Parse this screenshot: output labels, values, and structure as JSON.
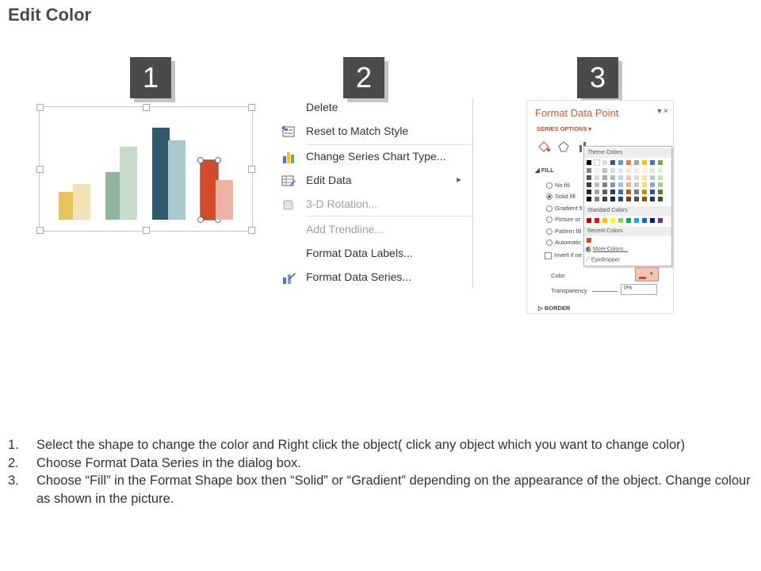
{
  "page": {
    "title": "Edit Color"
  },
  "steps": [
    "1",
    "2",
    "3"
  ],
  "panel1": {
    "bars": [
      {
        "color": "#e8c25a",
        "value": 35
      },
      {
        "color": "#f2e2b5",
        "value": 45
      },
      {
        "color": "#8fb59d",
        "value": 60
      },
      {
        "color": "#c8dccc",
        "value": 92
      },
      {
        "color": "#2f5b6c",
        "value": 116
      },
      {
        "color": "#a9c8d0",
        "value": 100
      },
      {
        "color": "#d14b28",
        "value": 75,
        "selected": true
      },
      {
        "color": "#edb3a3",
        "value": 50
      }
    ]
  },
  "context_menu": {
    "items": [
      {
        "label": "Delete",
        "icon": "none",
        "disabled": false
      },
      {
        "label": "Reset to Match Style",
        "icon": "reset-style-icon",
        "disabled": false
      },
      {
        "label": "Change Series Chart Type...",
        "icon": "chart-type-icon",
        "disabled": false
      },
      {
        "label": "Edit Data",
        "icon": "edit-data-icon",
        "disabled": false,
        "submenu": true
      },
      {
        "label": "3-D Rotation...",
        "icon": "rotation-icon",
        "disabled": true
      },
      {
        "label": "Add Trendline...",
        "icon": "none",
        "disabled": true
      },
      {
        "label": "Format Data Labels...",
        "icon": "none",
        "disabled": false
      },
      {
        "label": "Format Data Series...",
        "icon": "format-series-icon",
        "disabled": false
      }
    ],
    "submenu_arrow": "▸"
  },
  "format_pane": {
    "title": "Format Data Point",
    "controls": "▾ ×",
    "series_options": "SERIES OPTIONS ▾",
    "fill_header": "◢ FILL",
    "options": [
      {
        "label": "No fill",
        "checked": false
      },
      {
        "label": "Solid fill",
        "checked": true
      },
      {
        "label": "Gradient fi",
        "checked": false
      },
      {
        "label": "Picture or",
        "checked": false
      },
      {
        "label": "Pattern fill",
        "checked": false
      },
      {
        "label": "Automatic",
        "checked": false
      }
    ],
    "invert_label": "Invert if ne",
    "color_label": "Color",
    "transparency_label": "Transparency",
    "transparency_value": "0%",
    "border_label": "▷ BORDER",
    "palette": {
      "theme_label": "Theme Colors",
      "standard_label": "Standard Colors",
      "recent_label": "Recent Colors",
      "more_colors": "More Colors...",
      "eyedropper": "Eyedropper",
      "theme_top": [
        "#000000",
        "#ffffff",
        "#dcdcdc",
        "#44546a",
        "#5b9bd5",
        "#ed7d31",
        "#a5a5a5",
        "#ffc000",
        "#4472c4",
        "#70ad47"
      ],
      "theme_shades": [
        [
          "#7f7f7f",
          "#f2f2f2",
          "#c0c0c0",
          "#d6dce4",
          "#deeaf6",
          "#fbe4d5",
          "#ededed",
          "#fff2cc",
          "#d9e2f3",
          "#e2efd9"
        ],
        [
          "#595959",
          "#d9d9d9",
          "#a6a6a6",
          "#adb9ca",
          "#bdd6ee",
          "#f7caac",
          "#dbdbdb",
          "#ffe599",
          "#b4c6e7",
          "#c5e0b3"
        ],
        [
          "#3f3f3f",
          "#bfbfbf",
          "#808080",
          "#8497b0",
          "#9cc3e5",
          "#f4b183",
          "#c9c9c9",
          "#ffd966",
          "#8eaadb",
          "#a8d08d"
        ],
        [
          "#262626",
          "#a6a6a6",
          "#595959",
          "#333f4f",
          "#2e75b5",
          "#c55a11",
          "#7b7b7b",
          "#bf9000",
          "#2f5496",
          "#538135"
        ],
        [
          "#0d0d0d",
          "#808080",
          "#404040",
          "#222a35",
          "#1f4e79",
          "#833c0b",
          "#525252",
          "#7f6000",
          "#1f3864",
          "#375623"
        ]
      ],
      "standard": [
        "#c00000",
        "#ff0000",
        "#ffc000",
        "#ffff00",
        "#92d050",
        "#00b050",
        "#00b0f0",
        "#0070c0",
        "#002060",
        "#7030a0"
      ],
      "recent": [
        "#d14b28"
      ]
    }
  },
  "instructions": [
    {
      "num": "1.",
      "text": "Select the shape to change the color and Right click the object( click any object which you want to change color)"
    },
    {
      "num": "2.",
      "text": "Choose Format Data Series in the dialog box."
    },
    {
      "num": "3.",
      "text": "Choose “Fill” in the Format Shape box then “Solid” or “Gradient” depending on the appearance of the object. Change colour as shown in the picture."
    }
  ]
}
